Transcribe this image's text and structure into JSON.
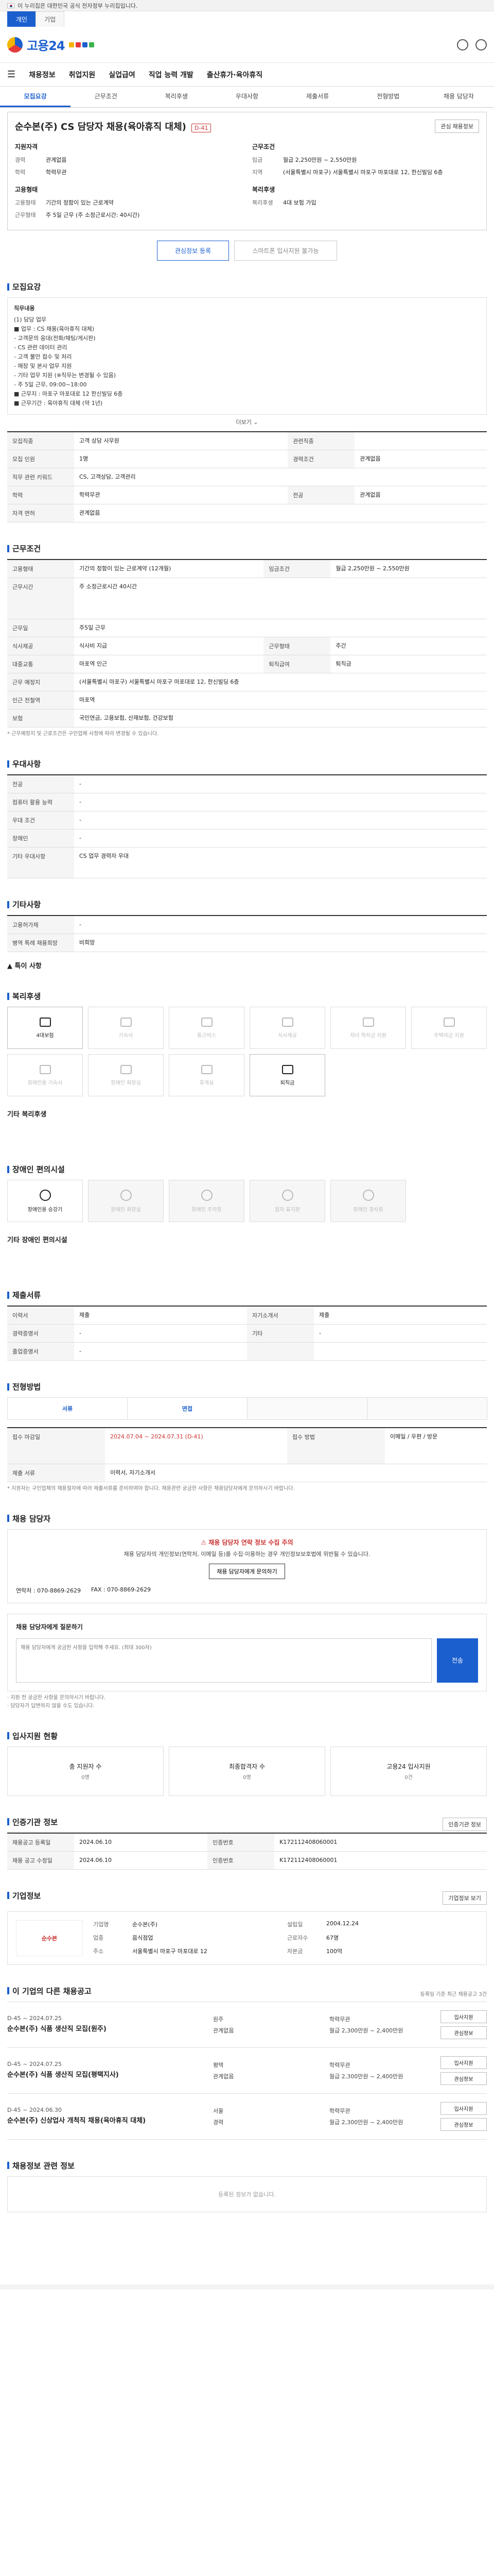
{
  "gov_bar": {
    "text": "이 누리집은 대한민국 공식 전자정부 누리집입니다."
  },
  "site_tabs": [
    "개인",
    "기업"
  ],
  "header": {
    "logo": "고용24"
  },
  "gnb": [
    "채용정보",
    "취업지원",
    "실업급여",
    "직업 능력 개발",
    "출산휴가·육아휴직"
  ],
  "subnav": [
    "모집요강",
    "근무조건",
    "복리후생",
    "우대사항",
    "제출서류",
    "전형방법",
    "채용 담당자"
  ],
  "job": {
    "title": "순수본(주) CS 담당자 채용(육아휴직 대체)",
    "dday": "D-41",
    "top_btn": "관심 채용정보",
    "left_head": "지원자격",
    "left_rows": [
      {
        "k": "경력",
        "v": "관계없음"
      },
      {
        "k": "학력",
        "v": "학력무관"
      }
    ],
    "right_head": "근무조건",
    "right_rows": [
      {
        "k": "임금",
        "v": "월급 2,250만원 ~ 2,550만원"
      },
      {
        "k": "지역",
        "v": "(서울특별시 마포구) 서울특별시 마포구 마포대로 12, 한신빌딩 6층"
      }
    ],
    "left_head2": "고용형태",
    "left_rows2": [
      {
        "k": "고용형태",
        "v": "기간의 정함이 있는 근로계약"
      },
      {
        "k": "근무형태",
        "v": "주 5일 근무 (주 소정근로시간: 40시간)"
      }
    ],
    "right_head2": "복리후생",
    "right_rows2": [
      {
        "k": "복리후생",
        "v": "4대 보험 가입"
      }
    ],
    "btn_apply": "관심정보 등록",
    "btn_mobile": "스마트폰 입사지원 불가능"
  },
  "recruit": {
    "title": "모집요강",
    "sub": "모집직종",
    "duty_label": "직무내용",
    "duty_lines": [
      "(1) 담당 업무",
      "■ 업무 : CS 채용(육아휴직 대체)",
      " - 고객문의 응대(전화/채팅/게시판)",
      " - CS 관련 데이터 관리",
      " - 고객 불만 접수 및 처리",
      " - 매장 및 본사 업무 지원",
      " - 기타 업무 지원 (※직무는 변경될 수 있음)",
      " - 주 5일 근무, 09:00~18:00",
      "■ 근무지 : 마포구 마포대로 12 한신빌딩 6층",
      "■ 근무기간 : 육아휴직 대체 (약 1년)"
    ],
    "more": "더보기",
    "rows": [
      {
        "k": "모집직종",
        "v": "고객 상담 사무원",
        "k2": "관련직종",
        "v2": ""
      },
      {
        "k": "모집 인원",
        "v": "1명",
        "k2": "경력조건",
        "v2": "관계없음"
      },
      {
        "k": "직무 관련 키워드",
        "v": "CS, 고객상담, 고객관리"
      },
      {
        "k": "학력",
        "v": "학력무관",
        "k2": "전공",
        "v2": "관계없음"
      },
      {
        "k": "자격 면허",
        "v": "관계없음"
      }
    ]
  },
  "conditions": {
    "title": "근무조건",
    "rows": [
      {
        "k": "고용형태",
        "v": "기간의 정함이 있는 근로계약 (12개월)",
        "k2": "임금조건",
        "v2": "월급 2,250만원 ~ 2,550만원"
      },
      {
        "k": "근무시간",
        "v": "주 소정근로시간 40시간"
      },
      {
        "k": "근무일",
        "v": "주5일 근무"
      },
      {
        "k": "식사제공",
        "v": "식사비 지급",
        "k2": "근무형태",
        "v2": "주간"
      },
      {
        "k": "대중교통",
        "v": "마포역 인근",
        "k2": "퇴직급여",
        "v2": "퇴직금"
      },
      {
        "k": "근무 예정지",
        "v": "(서울특별시 마포구) 서울특별시 마포구 마포대로 12, 한신빌딩 6층"
      },
      {
        "k": "인근 전철역",
        "v": "마포역"
      },
      {
        "k": "보험",
        "v": "국민연금, 고용보험, 산재보험, 건강보험"
      }
    ],
    "note": "* 근무예정지 및 근로조건은 구인업체 사정에 따라 변경될 수 있습니다."
  },
  "prefer": {
    "title": "우대사항",
    "rows": [
      {
        "k": "전공",
        "v": "-"
      },
      {
        "k": "컴퓨터 활용 능력",
        "v": "-"
      },
      {
        "k": "우대 조건",
        "v": "-"
      },
      {
        "k": "장애인",
        "v": "-"
      },
      {
        "k": "기타 우대사항",
        "v": "CS 업무 경력자 우대"
      }
    ]
  },
  "etc": {
    "title": "기타사항",
    "rows": [
      {
        "k": "고용허가제",
        "v": "-"
      },
      {
        "k": "병역 특례 채용희망",
        "v": "비희망"
      }
    ],
    "extra": "▲ 특이 사항"
  },
  "welfare": {
    "title": "복리후생",
    "items": [
      {
        "label": "4대보험",
        "on": true
      },
      {
        "label": "기숙사",
        "on": false
      },
      {
        "label": "통근버스",
        "on": false
      },
      {
        "label": "식사제공",
        "on": false
      },
      {
        "label": "자녀 학자금 지원",
        "on": false
      },
      {
        "label": "주택자금 지원",
        "on": false
      },
      {
        "label": "장애인용 기숙사",
        "on": false
      },
      {
        "label": "장애인 화장실",
        "on": false
      },
      {
        "label": "휴게실",
        "on": false
      },
      {
        "label": "퇴직금",
        "on": true
      }
    ],
    "extra": "기타 복리후생"
  },
  "disability": {
    "title": "장애인 편의시설",
    "items": [
      {
        "label": "장애인용 승강기",
        "on": true
      },
      {
        "label": "장애인 화장실",
        "on": false
      },
      {
        "label": "장애인 주차장",
        "on": false
      },
      {
        "label": "점자 표지판",
        "on": false
      },
      {
        "label": "장애인 경사로",
        "on": false
      }
    ],
    "extra": "기타 장애인 편의시설"
  },
  "docs": {
    "title": "제출서류",
    "rows": [
      {
        "k": "이력서",
        "v": "제출",
        "k2": "자기소개서",
        "v2": "제출"
      },
      {
        "k": "경력증명서",
        "v": "-",
        "k2": "기타",
        "v2": "-"
      },
      {
        "k": "졸업증명서",
        "v": "-",
        "k2": "",
        "v2": ""
      }
    ]
  },
  "method": {
    "title": "전형방법",
    "steps": [
      "서류",
      "면접",
      "",
      ""
    ],
    "rows": [
      {
        "k": "접수 마감일",
        "v": "2024.07.04 ~ 2024.07.31 (D-41)",
        "k2": "접수 방법",
        "v2": "이메일 / 우편 / 방문"
      },
      {
        "k": "제출 서류",
        "v": "이력서, 자기소개서"
      }
    ],
    "note": "* 지원자는 구인업체의 채용절차에 따라 제출서류를 준비하여야 합니다. 채용관련 궁금한 사항은 채용담당자에게 문의하시기 바랍니다."
  },
  "contact": {
    "title": "채용 담당자",
    "warn_title": "⚠ 채용 담당자 연락 정보 수집 주의",
    "warn_text": "채용 담당자의 개인정보(연락처, 이메일 등)를 수집·이용하는 경우 개인정보보호법에 위반될 수 있습니다.",
    "warn_btn": "채용 담당자에게 문의하기",
    "phone_label": "연락처",
    "phone": "070-8869-2629",
    "fax_label": "FAX",
    "fax": "070-8869-2629",
    "inq_label": "채용 담당자에게 질문하기",
    "inq_placeholder": "채용 담당자에게 궁금한 사항을 입력해 주세요. (최대 300자)",
    "inq_btn": "전송",
    "note1": "· 지원 전 궁금한 사항을 문의하시기 바랍니다.",
    "note2": "· 담당자가 답변하지 않을 수도 있습니다."
  },
  "visit": {
    "title": "입사지원 현황",
    "items": [
      {
        "label": "총 지원자 수",
        "n": "0명"
      },
      {
        "label": "최종합격자 수",
        "n": "0명"
      },
      {
        "label": "고용24 입사지원",
        "n": "0건"
      }
    ]
  },
  "manage": {
    "title": "인증기관 정보",
    "btn": "인증기관 정보",
    "rows": [
      {
        "k": "채용공고 등록일",
        "v": "2024.06.10",
        "k2": "인증번호",
        "v2": "K172112408060001"
      },
      {
        "k": "채용 공고 수정일",
        "v": "2024.06.10",
        "k2": "인증번호",
        "v2": "K172112408060001"
      }
    ]
  },
  "company": {
    "title": "기업정보",
    "btn": "기업정보 보기",
    "logo": "순수본",
    "rows": [
      {
        "k": "기업명",
        "v": "순수본(주)",
        "k2": "설립일",
        "v2": "2004.12.24"
      },
      {
        "k": "업종",
        "v": "음식점업",
        "k2": "근로자수",
        "v2": "67명"
      },
      {
        "k": "주소",
        "v": "서울특별시 마포구 마포대로 12",
        "k2": "자본금",
        "v2": "100억"
      }
    ]
  },
  "others": {
    "title": "이 기업의 다른 채용공고",
    "note": "등록일 기준 최근 채용공고 3건",
    "items": [
      {
        "date": "D-45",
        "period": "~ 2024.07.25",
        "title": "순수본(주) 식품 생산직 모집(원주)",
        "loc": "원주",
        "edu": "학력무관",
        "career": "관계없음",
        "pay": "월급 2,300만원 ~ 2,400만원"
      },
      {
        "date": "D-45",
        "period": "~ 2024.07.25",
        "title": "순수본(주) 식품 생산직 모집(평택지사)",
        "loc": "평택",
        "edu": "학력무관",
        "career": "관계없음",
        "pay": "월급 2,300만원 ~ 2,400만원"
      },
      {
        "date": "D-45",
        "period": "~ 2024.06.30",
        "title": "순수본(주) 신상업사 개척직 채용(육아휴직 대체)",
        "loc": "서울",
        "edu": "학력무관",
        "career": "경력",
        "pay": "월급 2,300만원 ~ 2,400만원"
      }
    ],
    "btn1": "입사지원",
    "btn2": "관심정보"
  },
  "keep": {
    "title": "채용정보 관련 정보",
    "empty": "등록된 정보가 없습니다."
  }
}
